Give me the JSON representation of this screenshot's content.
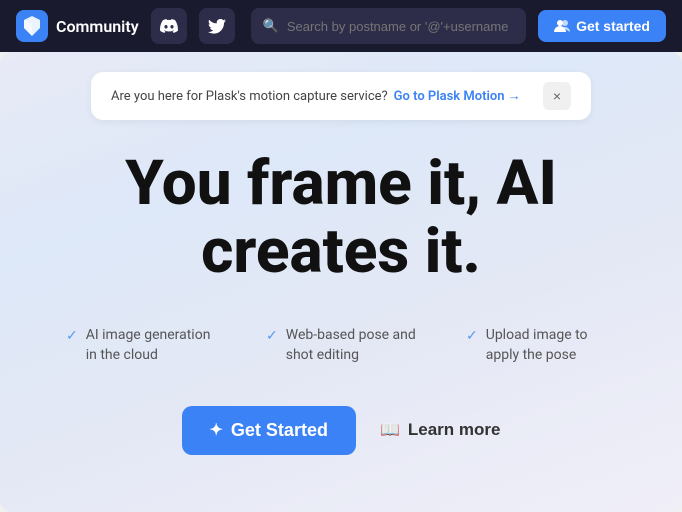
{
  "navbar": {
    "title": "Community",
    "discord_label": "Discord",
    "twitter_label": "Twitter",
    "search_placeholder": "Search by postname or '@'+username",
    "get_started_label": "Get started"
  },
  "banner": {
    "question": "Are you here for Plask's motion capture service?",
    "link_text": "Go to Plask Motion →",
    "close_label": "×"
  },
  "hero": {
    "line1": "You frame it, AI",
    "line2": "creates it."
  },
  "features": [
    {
      "text": "AI image generation in the cloud"
    },
    {
      "text": "Web-based pose and shot editing"
    },
    {
      "text": "Upload image to apply the pose"
    }
  ],
  "cta": {
    "get_started_label": "Get Started",
    "learn_more_label": "Learn more"
  },
  "icons": {
    "sparkle": "✦",
    "book": "📖",
    "check": "✓",
    "search": "🔍",
    "discord_char": "🎮",
    "twitter_char": "🐦",
    "users_icon": "👥",
    "close": "×"
  }
}
